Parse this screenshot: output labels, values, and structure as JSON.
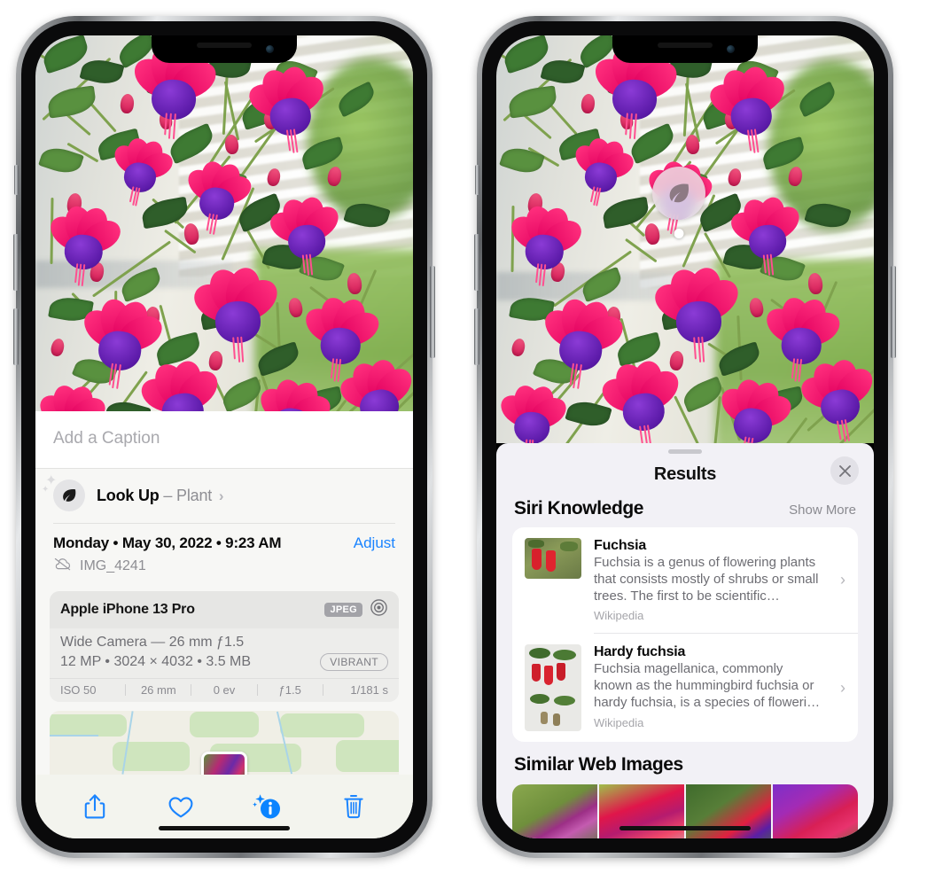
{
  "left_phone": {
    "photo_alt": "Fuchsia flowers hanging basket",
    "caption": {
      "placeholder": "Add a Caption",
      "value": ""
    },
    "look_up": {
      "label": "Look Up",
      "dash": "–",
      "subject": "Plant",
      "chevron": "›",
      "icon": "leaf-icon"
    },
    "metadata": {
      "date_line": "Monday • May 30, 2022 • 9:23 AM",
      "adjust_label": "Adjust",
      "filename": "IMG_4241",
      "cloud_icon": "cloud-slash-icon"
    },
    "camera_card": {
      "device": "Apple iPhone 13 Pro",
      "format_badge": "JPEG",
      "lens_icon": "aperture-icon",
      "lens_line": "Wide Camera — 26 mm ƒ1.5",
      "specs_line": "12 MP • 3024 × 4032 • 3.5 MB",
      "style_badge": "VIBRANT",
      "exif": [
        "ISO 50",
        "26 mm",
        "0 ev",
        "ƒ1.5",
        "1/181 s"
      ]
    },
    "toolbar": [
      {
        "name": "share-icon",
        "label": "Share"
      },
      {
        "name": "heart-icon",
        "label": "Favorite"
      },
      {
        "name": "info-sparkle-icon",
        "label": "Info"
      },
      {
        "name": "trash-icon",
        "label": "Delete"
      }
    ]
  },
  "right_phone": {
    "badge": {
      "icon": "leaf-icon",
      "label": "Visual Look Up"
    },
    "sheet": {
      "title": "Results",
      "close_label": "✕",
      "siri_knowledge": {
        "heading": "Siri Knowledge",
        "show_more": "Show More",
        "items": [
          {
            "title": "Fuchsia",
            "description": "Fuchsia is a genus of flowering plants that consists mostly of shrubs or small trees. The first to be scientific…",
            "source": "Wikipedia",
            "chevron": "›"
          },
          {
            "title": "Hardy fuchsia",
            "description": "Fuchsia magellanica, commonly known as the hummingbird fuchsia or hardy fuchsia, is a species of floweri…",
            "source": "Wikipedia",
            "chevron": "›"
          }
        ]
      },
      "similar_web_images": {
        "heading": "Similar Web Images",
        "thumbnails": [
          "web-image-1",
          "web-image-2",
          "web-image-3",
          "web-image-4"
        ]
      }
    }
  },
  "colors": {
    "accent_blue": "#1a84ff",
    "sheet_bg": "#f2f1f6",
    "card_bg": "#ffffff",
    "secondary_text": "#8e8e93"
  }
}
